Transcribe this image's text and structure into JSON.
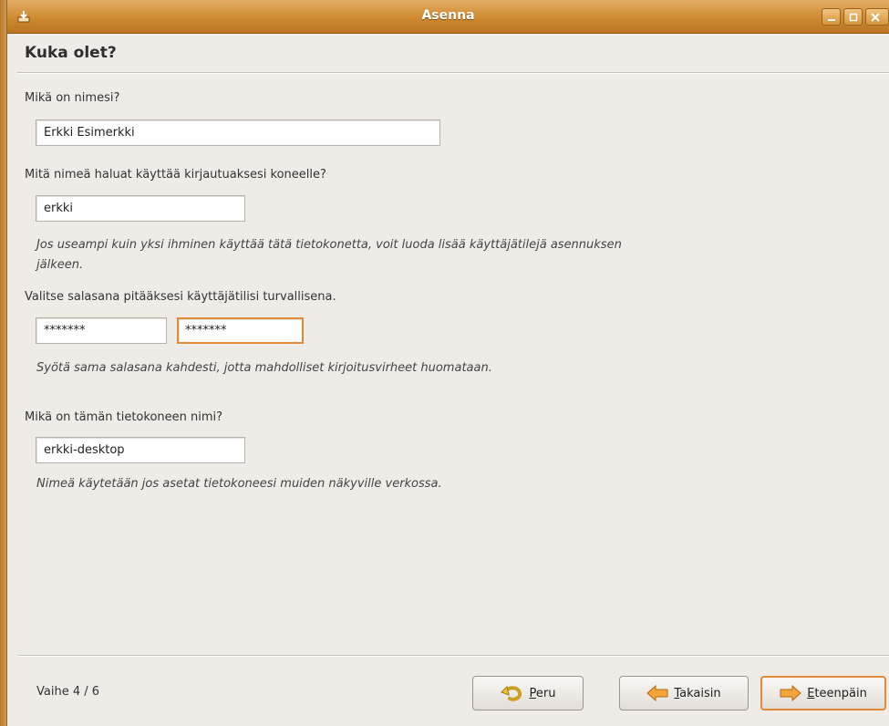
{
  "window": {
    "title": "Asenna"
  },
  "page": {
    "heading": "Kuka olet?"
  },
  "name_section": {
    "label": "Mikä on nimesi?",
    "value": "Erkki Esimerkki"
  },
  "login_section": {
    "label": "Mitä nimeä haluat käyttää kirjautuaksesi koneelle?",
    "value": "erkki",
    "hint_line1": "Jos useampi kuin yksi ihminen käyttää tätä tietokonetta, voit luoda lisää käyttäjätilejä asennuksen",
    "hint_line2": "jälkeen."
  },
  "password_section": {
    "label": "Valitse salasana pitääksesi käyttäjätilisi turvallisena.",
    "password_value": "*******",
    "confirm_value": "*******",
    "hint": "Syötä sama salasana kahdesti, jotta mahdolliset kirjoitusvirheet huomataan."
  },
  "computer_section": {
    "label": "Mikä on tämän tietokoneen nimi?",
    "value": "erkki-desktop",
    "hint": "Nimeä käytetään jos asetat tietokoneesi muiden näkyville verkossa."
  },
  "footer": {
    "step_text": "Vaihe 4 / 6",
    "cancel_mnemonic": "P",
    "cancel_rest": "eru",
    "back_mnemonic": "T",
    "back_rest": "akaisin",
    "forward_mnemonic": "E",
    "forward_rest": "teenpäin"
  },
  "icons": {
    "title": "installer-icon",
    "minimize": "minimize-icon",
    "maximize": "maximize-icon",
    "close": "close-icon",
    "cancel": "undo-arrow-icon",
    "back": "arrow-left-icon",
    "forward": "arrow-right-icon"
  },
  "colors": {
    "titlebar": "#cf8a32",
    "focus_border": "#e08a3a",
    "window_bg": "#efebe7"
  }
}
